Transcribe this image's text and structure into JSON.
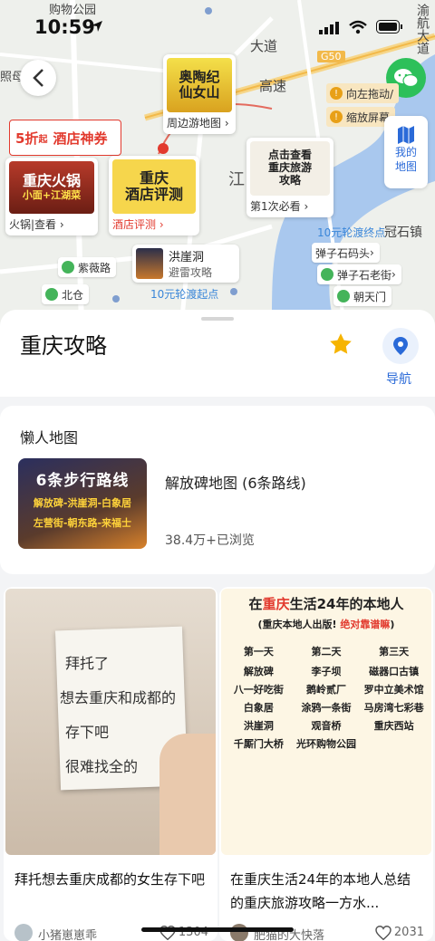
{
  "status_bar": {
    "time": "10:59"
  },
  "map": {
    "place_labels": [
      "购物公园",
      "照母",
      "大道",
      "G50",
      "高速",
      "渝航大道",
      "冠石镇",
      "江"
    ],
    "top_right_tips": [
      {
        "icon": "info",
        "text": "向左拖动/"
      },
      {
        "icon": "info",
        "text": "缩放屏幕"
      }
    ],
    "my_map": {
      "line1": "我的",
      "line2": "地图"
    },
    "pins": {
      "aotao": {
        "image_text": "奥陶纪\n仙女山",
        "caption": "周边游地图"
      },
      "explore": {
        "image_text": "点击查看\n重庆旅游\n攻略",
        "caption": "第1次必看"
      },
      "hotpot": {
        "image_text": "重庆火锅",
        "sub_text": "小面+江湖菜",
        "caption": "火锅|查看"
      },
      "hotel": {
        "image_text": "重庆\n酒店评测",
        "caption": "酒店评测"
      },
      "hongyadong": {
        "title": "洪崖洞",
        "sub": "避雷攻略"
      }
    },
    "hotel_deal": {
      "discount": "5折",
      "unit": "起",
      "label": "酒店神券"
    },
    "tags": [
      "紫薇路",
      "北仓",
      "弹子石码头",
      "弹子石老街",
      "朝天门"
    ],
    "ferry_labels": [
      "10元轮渡终点",
      "10元轮渡起点"
    ]
  },
  "sheet": {
    "title": "重庆攻略",
    "nav_label": "导航",
    "lazy_map": {
      "section_title": "懒人地图",
      "thumb_title": "6条步行路线",
      "thumb_line2": "解放碑-洪崖洞-白象居",
      "thumb_line3": "左营街-朝东路-来福士",
      "name": "解放碑地图 (6条路线)",
      "views": "38.4万+已浏览"
    },
    "posts": [
      {
        "image_lines": [
          "拜托了",
          "想去重庆和成都的",
          "存下吧",
          "很难找全的"
        ],
        "title": "拜托想去重庆成都的女生存下吧",
        "author": "小猪崽崽乖",
        "likes": "1304"
      },
      {
        "image_title_a": "在",
        "image_title_red": "重庆",
        "image_title_b": "生活24年的本地人",
        "image_subtitle": "(重庆本地人出版!",
        "image_subtitle_red": "绝对靠谱嘛",
        "days": [
          "第一天",
          "第二天",
          "第三天"
        ],
        "places": [
          "解放碑",
          "李子坝",
          "磁器口古镇",
          "八一好吃街",
          "鹅岭贰厂",
          "罗中立美术馆",
          "白象居",
          "涂鸦一条街",
          "马房湾七彩巷",
          "洪崖洞",
          "观音桥",
          "重庆西站",
          "千厮门大桥",
          "光环购物公园",
          ""
        ],
        "title": "在重庆生活24年的本地人总结的重庆旅游攻略一方水...",
        "author": "肥猫的大快落",
        "likes": "2031"
      }
    ]
  },
  "colors": {
    "accent_blue": "#2a6ad8",
    "wechat_green": "#2dc05a",
    "star_yellow": "#f6b400",
    "red": "#e23a2e"
  }
}
